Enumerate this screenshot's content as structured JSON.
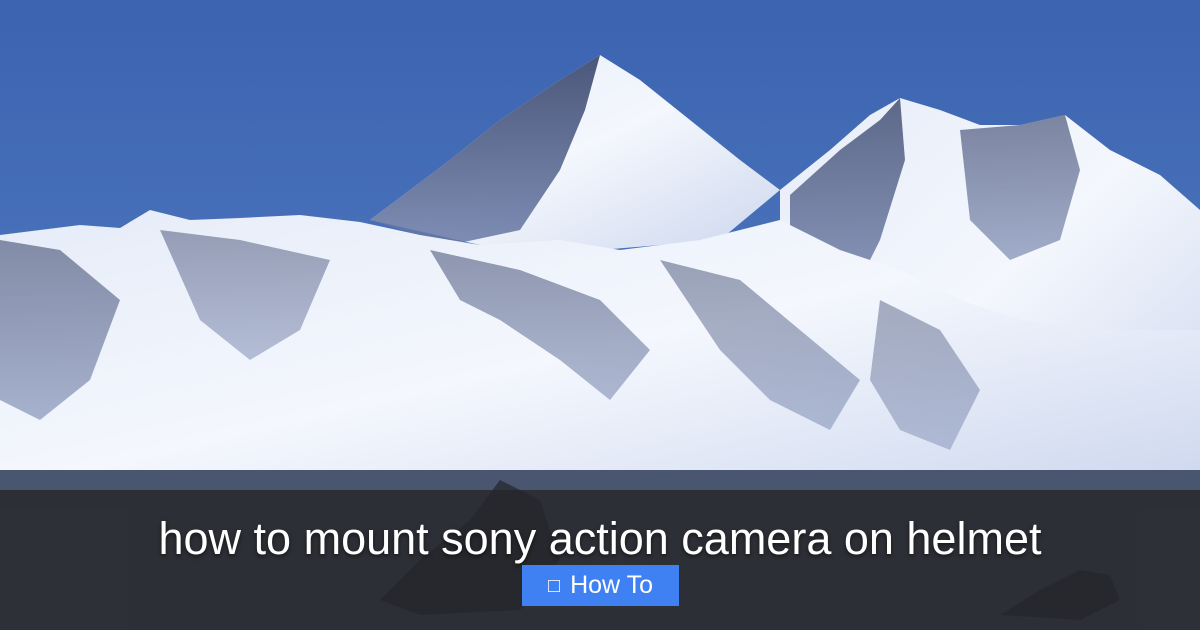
{
  "article": {
    "title": "how to mount sony action camera on helmet",
    "category": {
      "label": "How To",
      "icon": "folder-icon",
      "icon_glyph": "□"
    }
  },
  "background": {
    "subject": "snow-capped mountain range",
    "colors": {
      "sky": "#3f68b4",
      "snow": "#eef2fa",
      "rock_shadow": "#3a4a72",
      "overlay": "#262628",
      "badge": "#3f80f3"
    }
  }
}
